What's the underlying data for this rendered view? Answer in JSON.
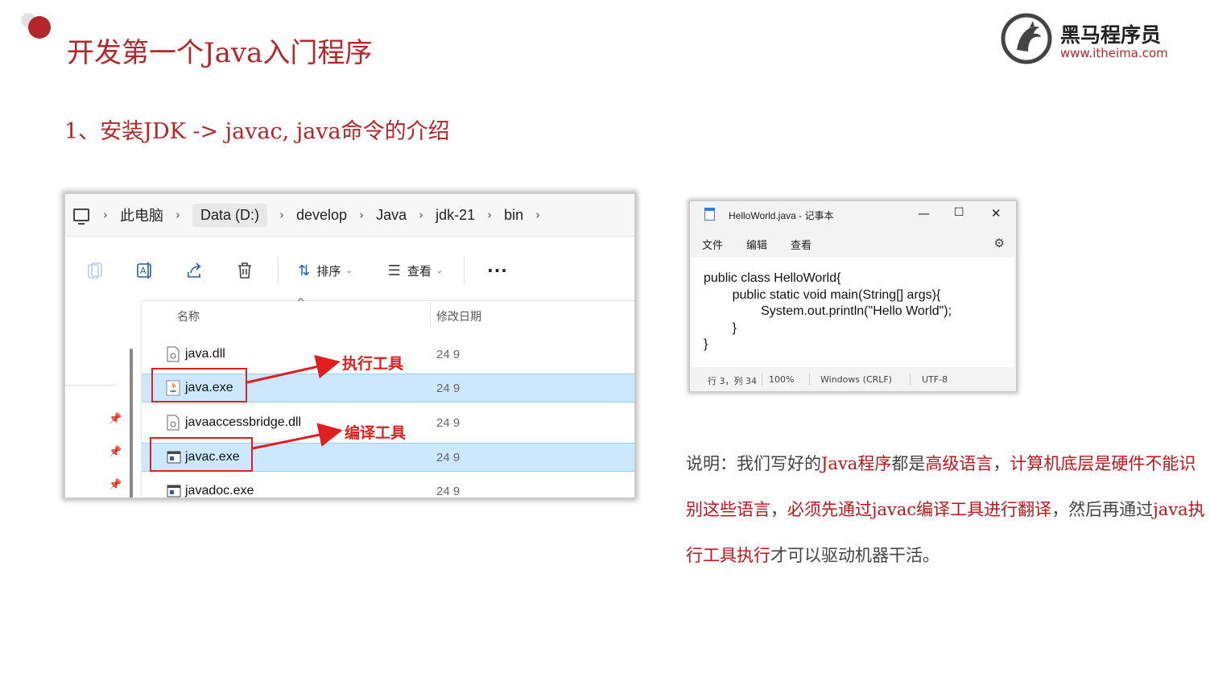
{
  "slide": {
    "title": "开发第一个Java入门程序",
    "subtitle": "1、安装JDK -> javac, java命令的介绍"
  },
  "logo": {
    "name": "黑马程序员",
    "url": "www.itheima.com"
  },
  "explorer": {
    "breadcrumb": [
      "此电脑",
      "Data (D:)",
      "develop",
      "Java",
      "jdk-21",
      "bin"
    ],
    "toolbar": {
      "sort_label": "排序",
      "view_label": "查看",
      "more_label": "···"
    },
    "columns": {
      "name": "名称",
      "date": "修改日期"
    },
    "files": [
      {
        "name": "java.dll",
        "date": "24 9",
        "selected": false,
        "icon": "dll-file-icon"
      },
      {
        "name": "java.exe",
        "date": "24 9",
        "selected": true,
        "icon": "java-exe-icon"
      },
      {
        "name": "javaaccessbridge.dll",
        "date": "24 9",
        "selected": false,
        "icon": "dll-file-icon"
      },
      {
        "name": "javac.exe",
        "date": "24 9",
        "selected": true,
        "icon": "exe-window-icon"
      },
      {
        "name": "javadoc.exe",
        "date": "24 9",
        "selected": false,
        "icon": "exe-window-icon"
      }
    ],
    "annotations": {
      "java_exe": "执行工具",
      "javac_exe": "编译工具"
    },
    "accent_red": "#e02020",
    "selection_color": "#cce8ff"
  },
  "notepad": {
    "title": "HelloWorld.java - 记事本",
    "menu": [
      "文件",
      "编辑",
      "查看"
    ],
    "code": "public class HelloWorld{\n        public static void main(String[] args){\n                System.out.println(\"Hello World\");\n        }\n}",
    "status": {
      "position": "行 3，列 34",
      "zoom": "100%",
      "line_ending": "Windows (CRLF)",
      "encoding": "UTF-8"
    }
  },
  "description": {
    "parts": [
      {
        "text": "说明：我们写好的",
        "highlight": false
      },
      {
        "text": "Java程序",
        "highlight": true
      },
      {
        "text": "都是",
        "highlight": false
      },
      {
        "text": "高级语言",
        "highlight": true
      },
      {
        "text": "，",
        "highlight": false
      },
      {
        "text": "计算机底层是硬件不能识别这些语言",
        "highlight": true
      },
      {
        "text": "，",
        "highlight": false
      },
      {
        "text": "必须先通过javac编译工具进行翻译",
        "highlight": true
      },
      {
        "text": "，然后再通过",
        "highlight": false
      },
      {
        "text": "java执行工具执行",
        "highlight": true
      },
      {
        "text": "才可以驱动机器干活。",
        "highlight": false
      }
    ]
  },
  "theme": {
    "brand_red": "#b3262a"
  }
}
